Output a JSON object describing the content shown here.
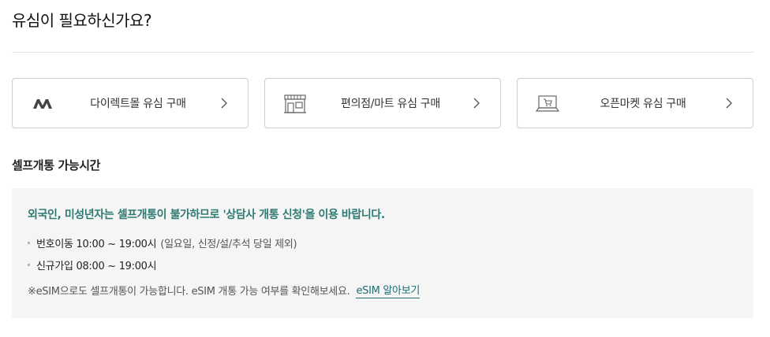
{
  "header": {
    "title": "유심이 필요하신가요?"
  },
  "cards": [
    {
      "label": "다이렉트몰 유심 구매",
      "icon": "direct-mall-logo-icon"
    },
    {
      "label": "편의점/마트 유심 구매",
      "icon": "store-icon"
    },
    {
      "label": "오픈마켓 유심 구매",
      "icon": "laptop-cart-icon"
    }
  ],
  "self_activation": {
    "title": "셀프개통 가능시간",
    "notice": "외국인, 미성년자는 셀프개통이 불가하므로 '상담사 개통 신청'을 이용 바랍니다.",
    "hours": [
      {
        "label": "번호이동 10:00 ~ 19:00시",
        "note": "(일요일, 신정/설/추석 당일 제외)"
      },
      {
        "label": "신규가입 08:00 ~ 19:00시"
      }
    ],
    "esim_note": "※eSIM으로도 셀프개통이 가능합니다. eSIM 개통 가능 여부를 확인해보세요.",
    "esim_link": "eSIM 알아보기"
  },
  "colors": {
    "accent": "#2e7a72",
    "link": "#1f6e72",
    "box_bg": "#f5f5f5"
  }
}
